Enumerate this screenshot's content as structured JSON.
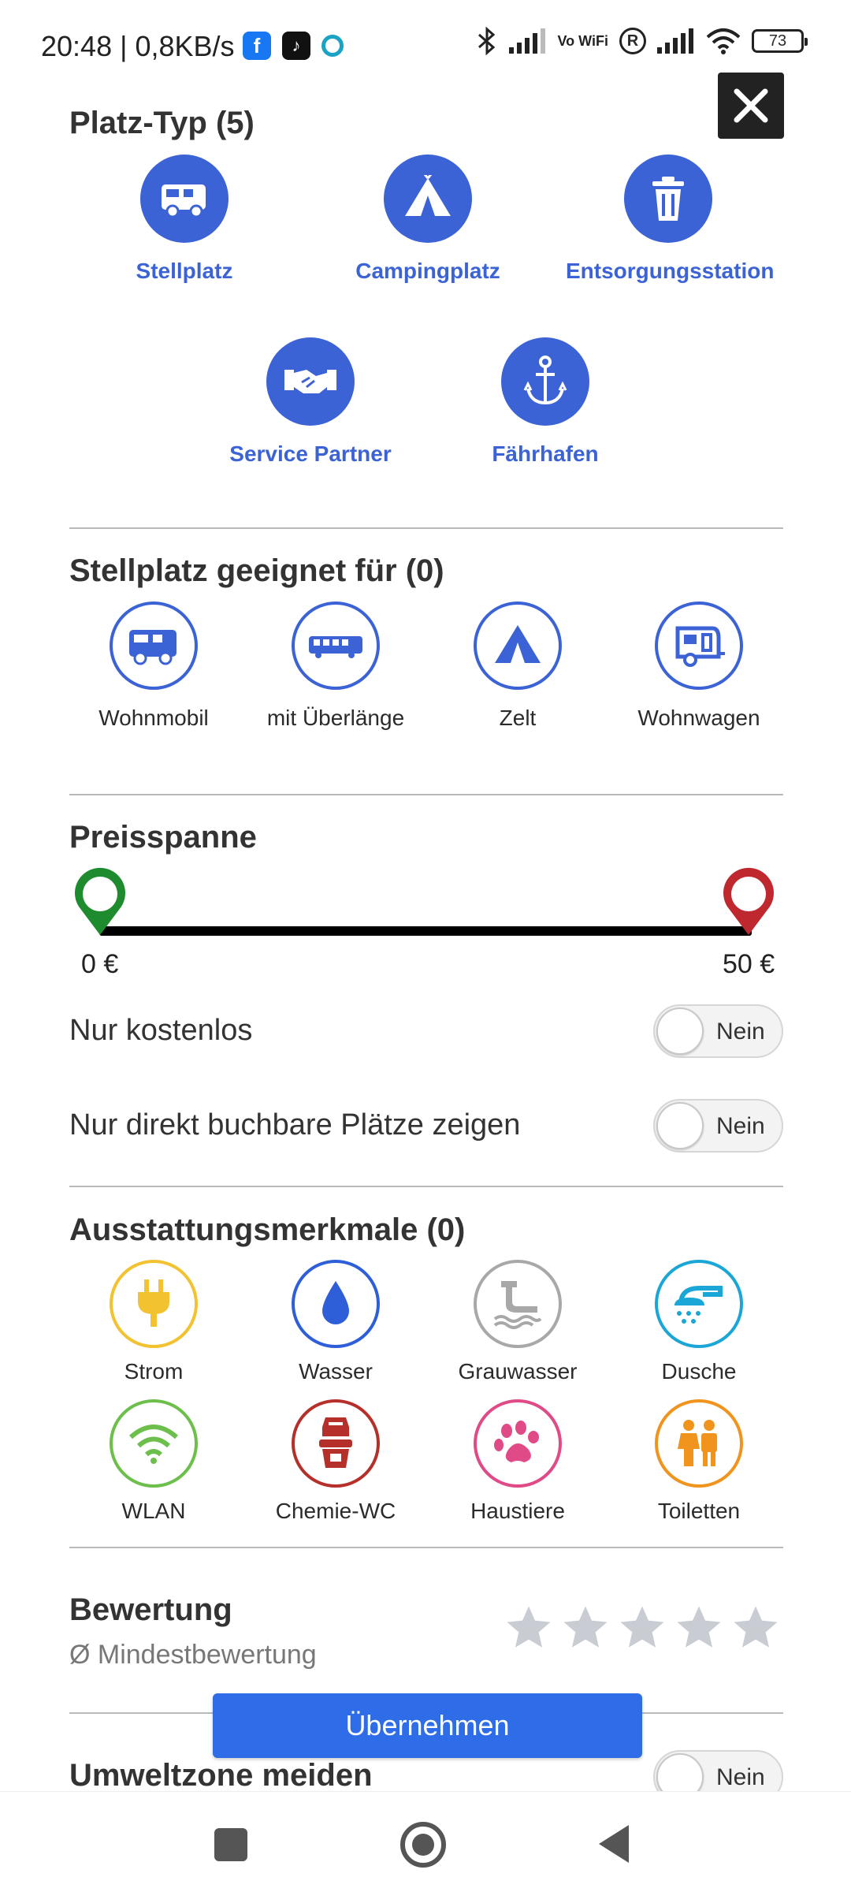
{
  "status_bar": {
    "time_speed": "20:48 | 0,8KB/s",
    "vowifi": "Vo WiFi",
    "r_badge": "R",
    "battery": "73"
  },
  "platz_typ": {
    "title": "Platz-Typ (5)",
    "items": [
      {
        "label": "Stellplatz",
        "icon": "camper-icon"
      },
      {
        "label": "Campingplatz",
        "icon": "tent-icon"
      },
      {
        "label": "Entsorgungsstation",
        "icon": "trash-can-icon"
      },
      {
        "label": "Service Partner",
        "icon": "handshake-icon"
      },
      {
        "label": "Fährhafen",
        "icon": "anchor-icon"
      }
    ]
  },
  "geeignet": {
    "title": "Stellplatz geeignet für (0)",
    "items": [
      {
        "label": "Wohnmobil",
        "icon": "motorhome-icon"
      },
      {
        "label": "mit Überlänge",
        "icon": "long-bus-icon"
      },
      {
        "label": "Zelt",
        "icon": "tent-icon"
      },
      {
        "label": "Wohnwagen",
        "icon": "caravan-icon"
      }
    ]
  },
  "preis": {
    "title": "Preisspanne",
    "min_label": "0 €",
    "max_label": "50 €",
    "only_free_label": "Nur kostenlos",
    "only_free_value": "Nein",
    "bookable_label": "Nur direkt buchbare Plätze zeigen",
    "bookable_value": "Nein"
  },
  "ausstattung": {
    "title": "Ausstattungsmerkmale (0)",
    "items": [
      {
        "label": "Strom",
        "icon": "plug-icon",
        "color": "#f2c230"
      },
      {
        "label": "Wasser",
        "icon": "water-drop-icon",
        "color": "#2f5fd8"
      },
      {
        "label": "Grauwasser",
        "icon": "grey-water-icon",
        "color": "#a8a8a8"
      },
      {
        "label": "Dusche",
        "icon": "shower-icon",
        "color": "#1aa6d6"
      },
      {
        "label": "WLAN",
        "icon": "wifi-icon",
        "color": "#6cbf4a"
      },
      {
        "label": "Chemie-WC",
        "icon": "chemical-toilet-icon",
        "color": "#b5302a"
      },
      {
        "label": "Haustiere",
        "icon": "paw-icon",
        "color": "#e04a86"
      },
      {
        "label": "Toiletten",
        "icon": "toilets-icon",
        "color": "#f0941d"
      }
    ]
  },
  "bewertung": {
    "title": "Bewertung",
    "subtitle": "Ø Mindestbewertung",
    "stars_selected": 0,
    "stars_total": 5
  },
  "umweltzone": {
    "title": "Umweltzone meiden",
    "value": "Nein"
  },
  "apply_label": "Übernehmen"
}
